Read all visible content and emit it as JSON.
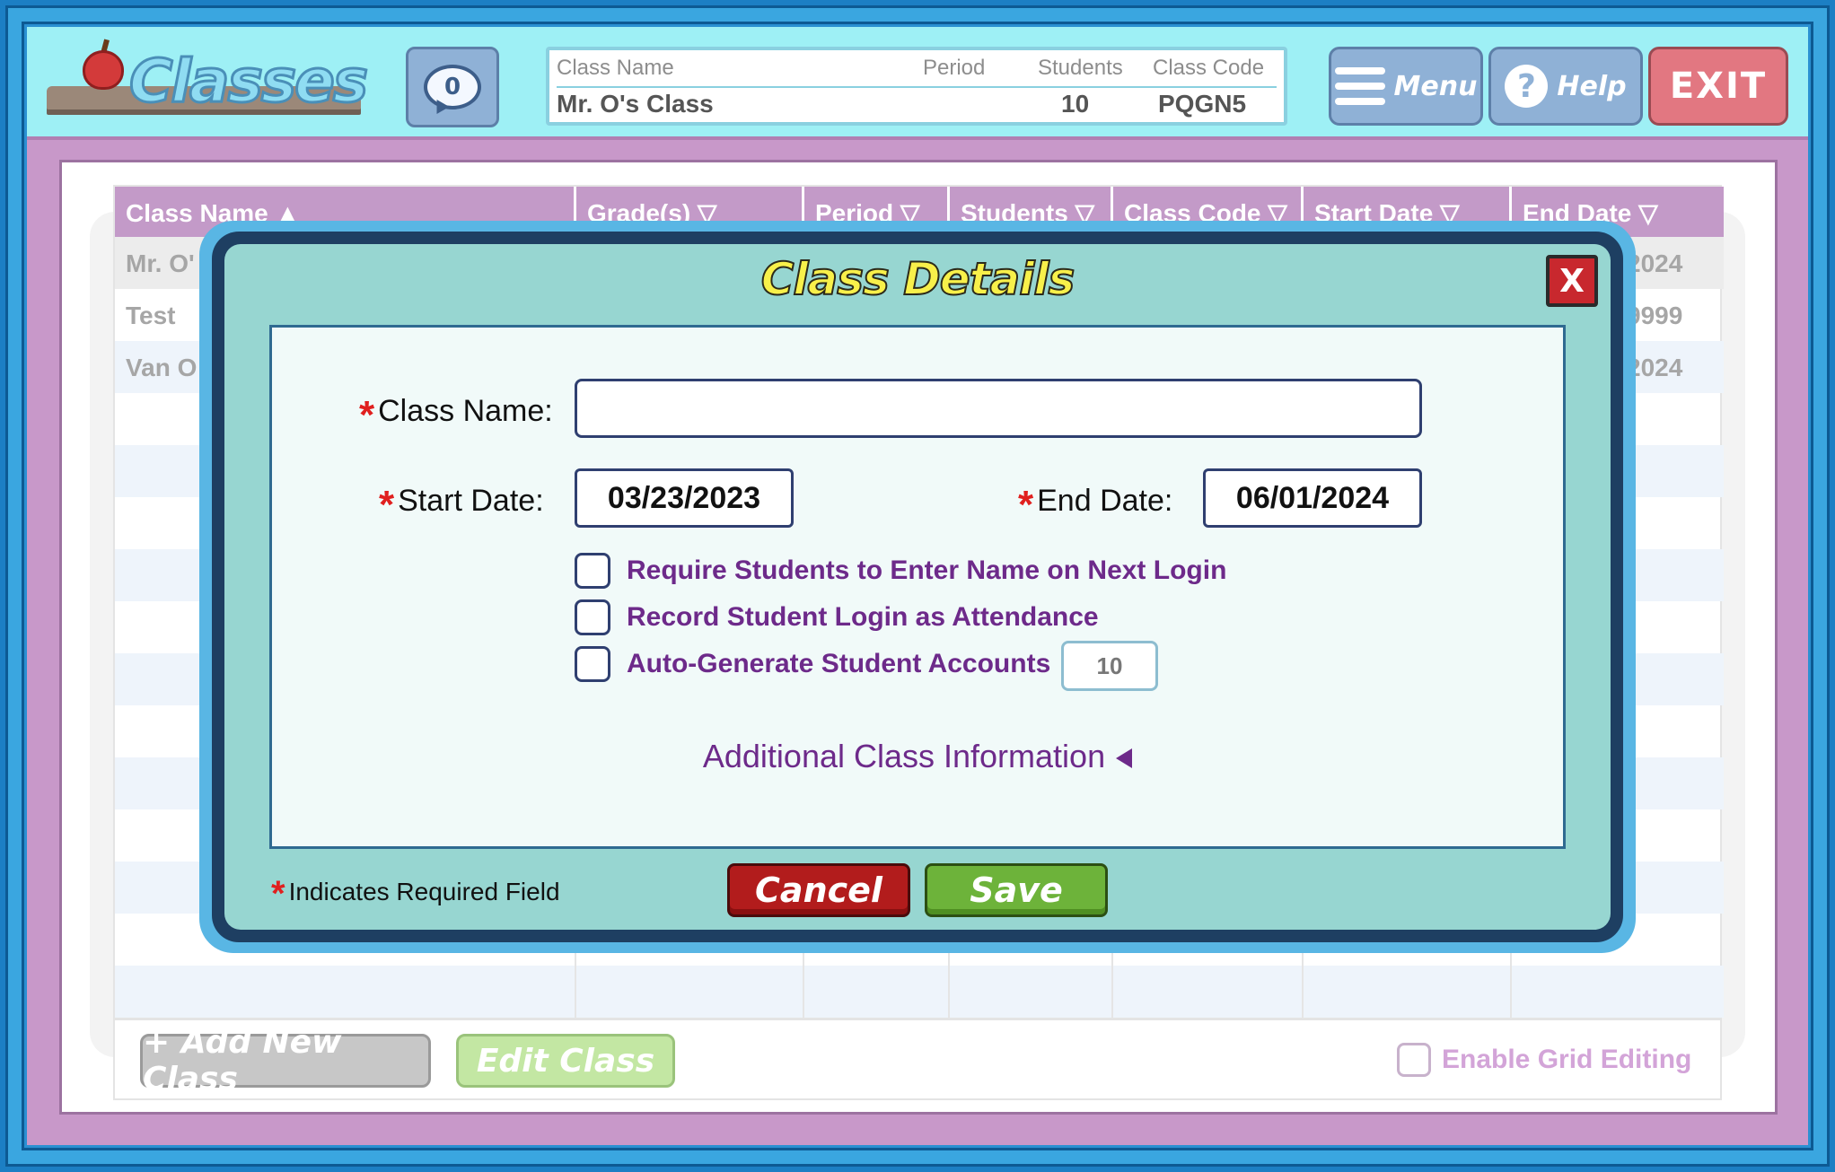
{
  "header": {
    "logo_text": "Classes",
    "message_count": "0",
    "summary": {
      "head_class_name": "Class Name",
      "head_period": "Period",
      "head_students": "Students",
      "head_class_code": "Class Code",
      "class_name": "Mr. O's Class",
      "period": "",
      "students": "10",
      "class_code": "PQGN5"
    },
    "menu_label": "Menu",
    "help_label": "Help",
    "help_glyph": "?",
    "exit_label": "EXIT"
  },
  "grid": {
    "columns": [
      {
        "label": "Class Name ▲"
      },
      {
        "label": "Grade(s) ▽"
      },
      {
        "label": "Period ▽"
      },
      {
        "label": "Students ▽"
      },
      {
        "label": "Class Code ▽"
      },
      {
        "label": "Start Date ▽"
      },
      {
        "label": "End Date ▽"
      }
    ],
    "rows": [
      {
        "class_name": "Mr. O'",
        "end_date": "2024"
      },
      {
        "class_name": "Test",
        "end_date": "9999"
      },
      {
        "class_name": "Van O",
        "end_date": "2024"
      }
    ]
  },
  "footer": {
    "add_button": "+ Add New Class",
    "edit_button": "Edit Class",
    "grid_editing_label": "Enable Grid Editing"
  },
  "modal": {
    "title": "Class Details",
    "close_label": "X",
    "required_marker": "*",
    "class_name_label": "Class Name:",
    "class_name_value": "",
    "start_date_label": "Start Date:",
    "start_date_value": "03/23/2023",
    "end_date_label": "End Date:",
    "end_date_value": "06/01/2024",
    "options": [
      {
        "label": "Require Students to Enter Name on Next Login",
        "checked": false
      },
      {
        "label": "Record Student Login as Attendance",
        "checked": false
      },
      {
        "label": "Auto-Generate Student Accounts",
        "checked": false
      }
    ],
    "auto_generate_count": "10",
    "additional_info_label": "Additional Class Information",
    "required_note": "Indicates Required Field",
    "cancel_label": "Cancel",
    "save_label": "Save"
  },
  "colors": {
    "frame_blue": "#1c7fc4",
    "header_cyan": "#9ef0f5",
    "main_purple": "#c898c9",
    "modal_teal": "#97d6d1",
    "title_yellow": "#f8f04a",
    "option_purple": "#6d2a8a",
    "required_red": "#e0201f",
    "cancel_red": "#b21c1c",
    "save_green": "#6db33a"
  }
}
